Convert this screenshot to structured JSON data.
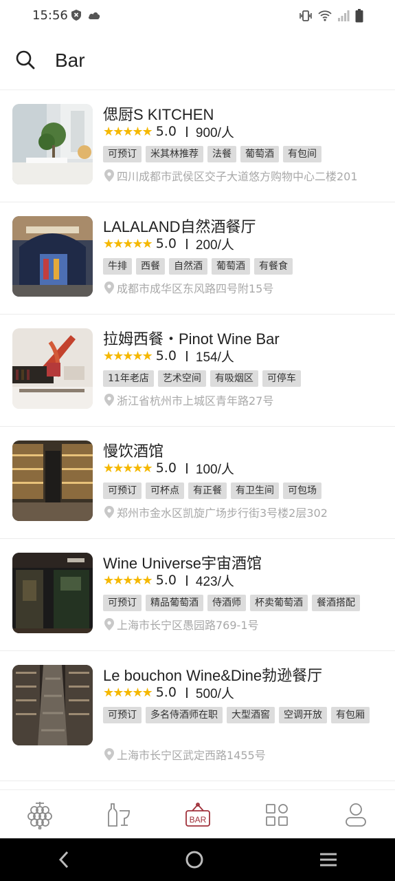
{
  "status": {
    "time": "15:56"
  },
  "header": {
    "title": "Bar"
  },
  "items": [
    {
      "name": "偲厨S KITCHEN",
      "score": "5.0",
      "price": "900/人",
      "tags": [
        "可预订",
        "米其林推荐",
        "法餐",
        "葡萄酒",
        "有包间"
      ],
      "address": "四川成都市武侯区交子大道悠方购物中心二楼201"
    },
    {
      "name": "LALALAND自然酒餐厅",
      "score": "5.0",
      "price": "200/人",
      "tags": [
        "牛排",
        "西餐",
        "自然酒",
        "葡萄酒",
        "有餐食"
      ],
      "address": "成都市成华区东风路四号附15号"
    },
    {
      "name": "拉姆西餐・Pinot Wine Bar",
      "score": "5.0",
      "price": "154/人",
      "tags": [
        "11年老店",
        "艺术空间",
        "有吸烟区",
        "可停车"
      ],
      "address": "浙江省杭州市上城区青年路27号"
    },
    {
      "name": "慢饮酒馆",
      "score": "5.0",
      "price": "100/人",
      "tags": [
        "可预订",
        "可杯点",
        "有正餐",
        "有卫生间",
        "可包场"
      ],
      "address": "郑州市金水区凯旋广场步行街3号楼2层302"
    },
    {
      "name": "Wine Universe宇宙酒馆",
      "score": "5.0",
      "price": "423/人",
      "tags": [
        "可预订",
        "精品葡萄酒",
        "侍酒师",
        "杯卖葡萄酒",
        "餐酒搭配"
      ],
      "address": "上海市长宁区愚园路769-1号"
    },
    {
      "name": "Le bouchon Wine&Dine勃逊餐厅",
      "score": "5.0",
      "price": "500/人",
      "tags": [
        "可预订",
        "多名侍酒师在职",
        "大型酒窖",
        "空调开放",
        "有包厢"
      ],
      "address": "上海市长宁区武定西路1455号"
    }
  ],
  "tabbar": {
    "bar_label": "BAR",
    "accent": "#a0313b"
  }
}
